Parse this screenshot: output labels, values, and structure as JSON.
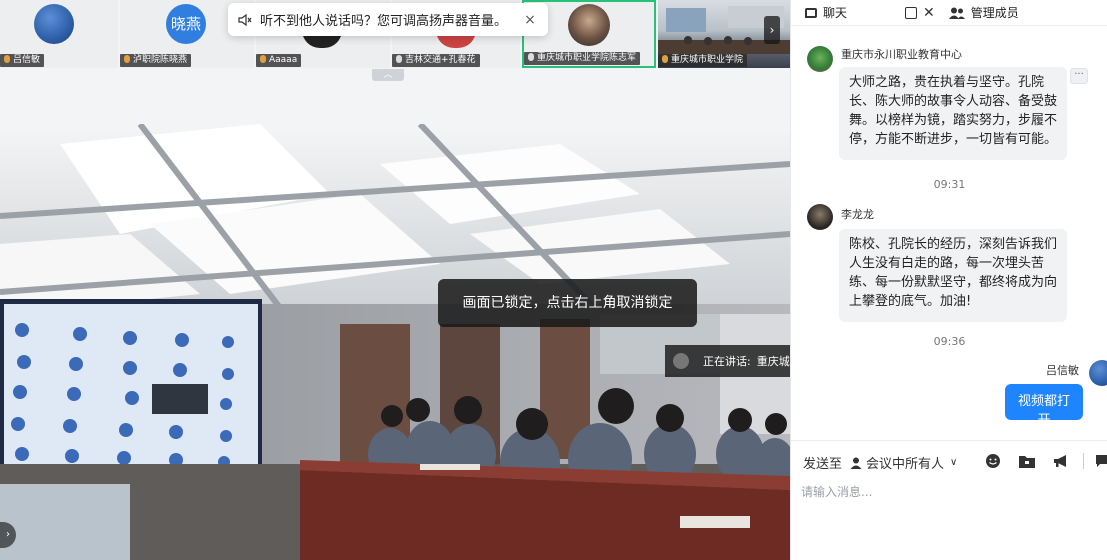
{
  "thumbnails": [
    {
      "name": "吕信敏",
      "avatar_text": ""
    },
    {
      "name": "泸职院陈晓燕",
      "avatar_text": "晓燕"
    },
    {
      "name": "Aaaaa",
      "avatar_text": ""
    },
    {
      "name": "吉林交通+孔春花",
      "avatar_text": ""
    },
    {
      "name": "重庆城市职业学院陈志军",
      "avatar_text": ""
    },
    {
      "name": "重庆城市职业学院",
      "avatar_text": ""
    }
  ],
  "toast": {
    "text": "听不到他人说话吗？您可调高扬声器音量。",
    "close": "×"
  },
  "collapse_glyph": "︿",
  "lock_message": "画面已锁定，点击右上角取消锁定",
  "speaker": {
    "label": "正在讲话:",
    "name": "重庆城市职业学院..."
  },
  "chat": {
    "tab_chat": "聊天",
    "tab_members": "管理成员",
    "messages": [
      {
        "sender": "重庆市永川职业教育中心",
        "text": "大师之路，贵在执着与坚守。孔院长、陈大师的故事令人动容、备受鼓舞。以榜样为镜，踏实努力，步履不停，方能不断进步，一切皆有可能。"
      },
      {
        "time": "09:31"
      },
      {
        "sender": "李龙龙",
        "text": "陈校、孔院长的经历，深刻告诉我们人生没有白走的路，每一次埋头苦练、每一份默默坚守，都终将成为向上攀登的底气。加油!"
      },
      {
        "time": "09:36"
      },
      {
        "sender": "吕信敏",
        "text": "视频都打开",
        "self": true
      }
    ],
    "send_to_label": "发送至",
    "send_to_value": "会议中所有人",
    "input_placeholder": "请输入消息...",
    "more_label": "···"
  },
  "colors": {
    "accent": "#1f85ff",
    "bubble": "#f1f2f4",
    "active_border": "#27c27a"
  },
  "icons": [
    "speaker-icon",
    "close-icon",
    "chat-icon",
    "popout-icon",
    "members-icon",
    "emoji-icon",
    "folder-icon",
    "megaphone-icon",
    "person-icon",
    "chevron-down-icon",
    "mic-icon"
  ]
}
